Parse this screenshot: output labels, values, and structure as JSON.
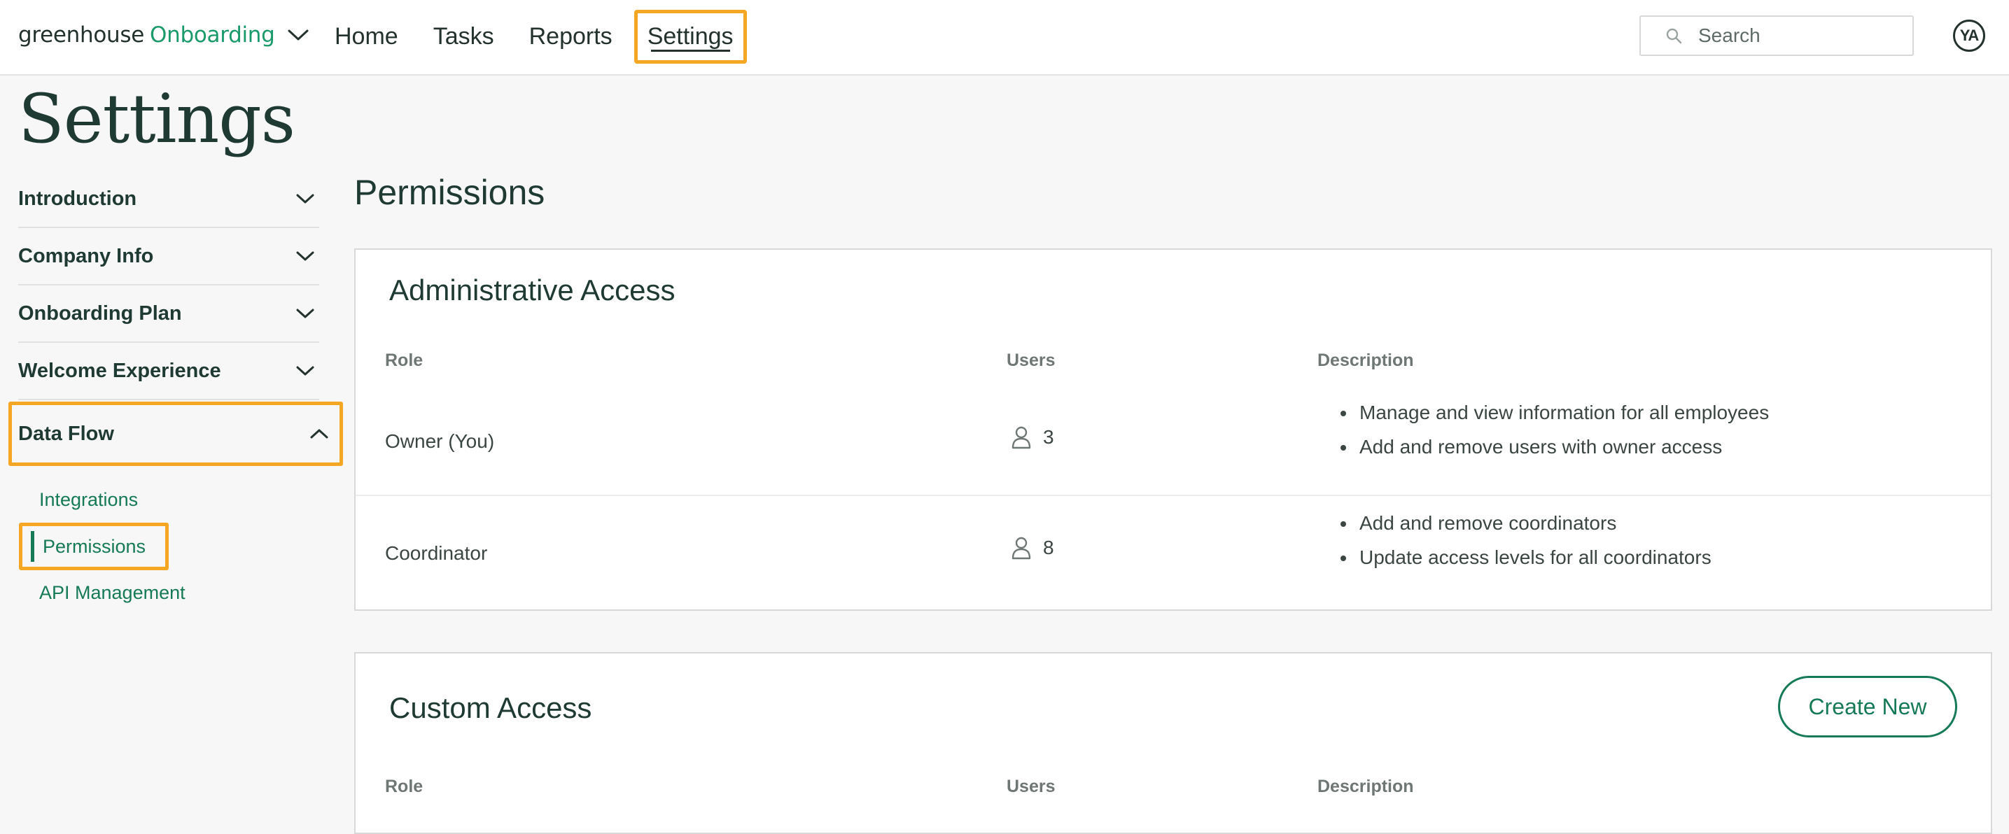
{
  "brand": {
    "name_left": "greenhouse",
    "name_right": "Onboarding",
    "accent_color": "#1a9a6b"
  },
  "nav": {
    "items": [
      {
        "label": "Home"
      },
      {
        "label": "Tasks"
      },
      {
        "label": "Reports"
      },
      {
        "label": "Settings"
      }
    ],
    "active": "Settings"
  },
  "search": {
    "placeholder": "Search",
    "value": ""
  },
  "user": {
    "initials": "YA"
  },
  "page": {
    "title": "Settings"
  },
  "sidebar": {
    "sections": [
      {
        "label": "Introduction",
        "expanded": false
      },
      {
        "label": "Company Info",
        "expanded": false
      },
      {
        "label": "Onboarding Plan",
        "expanded": false
      },
      {
        "label": "Welcome Experience",
        "expanded": false
      },
      {
        "label": "Data Flow",
        "expanded": true
      }
    ],
    "data_flow_items": [
      {
        "label": "Integrations"
      },
      {
        "label": "Permissions",
        "active": true
      },
      {
        "label": "API Management"
      }
    ]
  },
  "main": {
    "title": "Permissions",
    "admin_card": {
      "title": "Administrative Access",
      "columns": {
        "role": "Role",
        "users": "Users",
        "description": "Description"
      },
      "rows": [
        {
          "role": "Owner (You)",
          "users": "3",
          "description": [
            "Manage and view information for all employees",
            "Add and remove users with owner access"
          ]
        },
        {
          "role": "Coordinator",
          "users": "8",
          "description": [
            "Add and remove coordinators",
            "Update access levels for all coordinators"
          ]
        }
      ]
    },
    "custom_card": {
      "title": "Custom Access",
      "create_button": "Create New",
      "columns": {
        "role": "Role",
        "users": "Users",
        "description": "Description"
      }
    }
  },
  "colors": {
    "highlight": "#f5a623",
    "link_green": "#157a55",
    "heading": "#1e3a33"
  }
}
